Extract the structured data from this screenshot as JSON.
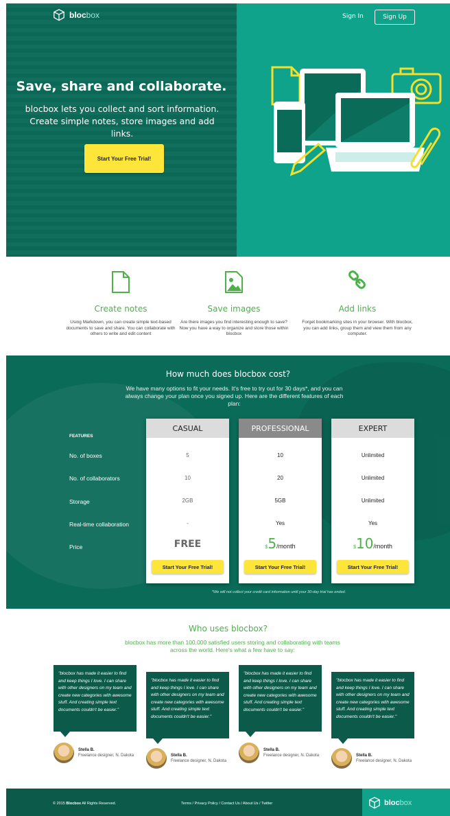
{
  "header": {
    "logo_bold": "bloc",
    "logo_light": "box",
    "signin_label": "Sign In",
    "signup_label": "Sign Up"
  },
  "hero": {
    "title": "Save, share and collaborate.",
    "subtitle": "blocbox lets you collect and sort information. Create simple notes, store images and add links.",
    "cta_label": "Start Your Free Trial!"
  },
  "features": [
    {
      "icon": "document-icon",
      "title": "Create notes",
      "text": "Using Markdown, you can create simple text-based documents to save and share. You can collaborate with others to write and edit content"
    },
    {
      "icon": "image-icon",
      "title": "Save images",
      "text": "Are there images you find interesting enough to save? Now you have a way to organize and store those within blocbox"
    },
    {
      "icon": "link-icon",
      "title": "Add links",
      "text": "Forget bookmarking sites in your browser. With blocbox, you can add links, group them and view them from any computer."
    }
  ],
  "pricing": {
    "title": "How much does blocbox cost?",
    "intro": "We have many options to fit your needs. It's free to try out for 30 days*, and you can always change your plan once you signed up. Here are the different features of each plan:",
    "features_heading": "FEATURES",
    "rows": [
      "No. of boxes",
      "No. of collaborators",
      "Storage",
      "Real-time collaboration",
      "Price"
    ],
    "plans": [
      {
        "name": "CASUAL",
        "boxes": "5",
        "collaborators": "10",
        "storage": "2GB",
        "realtime": "-",
        "price_label": "FREE",
        "cta": "Start Your Free Trial!"
      },
      {
        "name": "PROFESSIONAL",
        "boxes": "10",
        "collaborators": "20",
        "storage": "5GB",
        "realtime": "Yes",
        "currency": "$",
        "amount": "5",
        "period": "/month",
        "cta": "Start Your Free Trial!"
      },
      {
        "name": "EXPERT",
        "boxes": "Unlimited",
        "collaborators": "Unlimited",
        "storage": "Unlimited",
        "realtime": "Yes",
        "currency": "$",
        "amount": "10",
        "period": "/month",
        "cta": "Start Your Free Trial!"
      }
    ],
    "disclaimer": "*We will not collect your credit card information until your 30-day trial has ended."
  },
  "users": {
    "title": "Who uses blocbox?",
    "intro": "blocbox has more than 100,000 satisfied users storing and collaborating with teams across the world. Here's what a few have to say:",
    "testimonials": [
      {
        "quote": "\"blocbox has made it easier to find and keep things I love. I can share with other designers on my team and create new categories with awesome stuff. And creating simple text documents couldn't be easier.\"",
        "name": "Stella B.",
        "role": "Freelance designer, N. Dakota"
      },
      {
        "quote": "\"blocbox has made it easier to find and keep things I love. I can share with other designers on my team and create new categories with awesome stuff. And creating simple text documents couldn't be easier.\"",
        "name": "Stella B.",
        "role": "Freelance designer, N. Dakota"
      },
      {
        "quote": "\"blocbox has made it easier to find and keep things I love. I can share with other designers on my team and create new categories with awesome stuff. And creating simple text documents couldn't be easier.\"",
        "name": "Stella B.",
        "role": "Freelance designer, N. Dakota"
      },
      {
        "quote": "\"blocbox has made it easier to find and keep things I love. I can share with other designers on my team and create new categories with awesome stuff. And creating simple text documents couldn't be easier.\"",
        "name": "Stella B.",
        "role": "Freelance designer, N. Dakota"
      }
    ]
  },
  "footer": {
    "copy_prefix": "© 2015",
    "copy_brand": "Blocbox",
    "copy_suffix": "All Rights Reserved.",
    "links": [
      "Terms",
      "Privacy Policy",
      "Contact Us",
      "About Us",
      "Twitter"
    ],
    "logo_bold": "bloc",
    "logo_light": "box"
  },
  "colors": {
    "dark_teal": "#0b6b59",
    "teal": "#10a38b",
    "green_accent": "#4db14a",
    "yellow_cta": "#fde53a"
  }
}
